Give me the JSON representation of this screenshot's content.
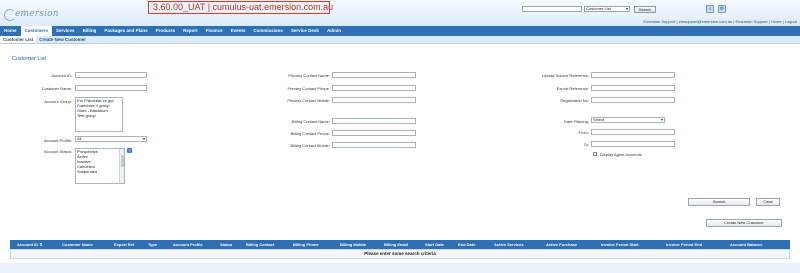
{
  "header": {
    "logo_text": "emersion",
    "environment_label": "3.60.00_UAT | cumulus-uat.emersion.com.au",
    "search": {
      "value": "",
      "select_value": "Customer List",
      "button_label": "Search"
    },
    "icons": [
      "home-icon",
      "settings-icon",
      "help-icon"
    ],
    "user_info": "Emersion Support | emsupport@emersion.com.au | Emersion Support | Home | Logout"
  },
  "nav": {
    "items": [
      {
        "label": "Home"
      },
      {
        "label": "Customers",
        "active": true
      },
      {
        "label": "Services"
      },
      {
        "label": "Billing"
      },
      {
        "label": "Packages and Plans"
      },
      {
        "label": "Products"
      },
      {
        "label": "Report"
      },
      {
        "label": "Finance"
      },
      {
        "label": "Events"
      },
      {
        "label": "Commissions"
      },
      {
        "label": "Service Desk"
      },
      {
        "label": "Admin"
      }
    ]
  },
  "subnav": {
    "items": [
      {
        "label": "Customer List",
        "active": true
      },
      {
        "label": "Create New Customer"
      }
    ]
  },
  "page_title": "Customer List",
  "form": {
    "col1": {
      "account_id": {
        "label": "Account ID:",
        "value": ""
      },
      "customer_name": {
        "label": "Customer Name:",
        "value": ""
      },
      "account_group": {
        "label": "Account Group:",
        "options": [
          "For Franchise zz grp",
          "Franchise Y group",
          "Store - Blackburn",
          "Test group"
        ]
      },
      "account_profile": {
        "label": "Account Profile:",
        "value": "All"
      },
      "account_status": {
        "label": "Account Status:",
        "options": [
          "Prospective",
          "Active",
          "Inactive",
          "Cancelled",
          "Suspended"
        ]
      }
    },
    "col2": {
      "primary_contact_name": {
        "label": "Primary Contact Name:",
        "value": ""
      },
      "primary_contact_phone": {
        "label": "Primary Contact Phone:",
        "value": ""
      },
      "primary_contact_mobile": {
        "label": "Primary Contact Mobile:",
        "value": ""
      },
      "billing_contact_name": {
        "label": "Billing Contact Name:",
        "value": ""
      },
      "billing_contact_phone": {
        "label": "Billing Contact Phone:",
        "value": ""
      },
      "billing_contact_mobile": {
        "label": "Billing Contact Mobile:",
        "value": ""
      }
    },
    "col3": {
      "upload_source_reference": {
        "label": "Upload Source Reference:",
        "value": ""
      },
      "export_reference": {
        "label": "Export Reference:",
        "value": ""
      },
      "registration_no": {
        "label": "Registration No:",
        "value": ""
      },
      "date_filtering": {
        "label": "Date Filtering:",
        "value": "Select"
      },
      "from": {
        "label": "From:",
        "value": ""
      },
      "to": {
        "label": "To:",
        "value": ""
      },
      "display_agent_accounts": {
        "label": "Display Agent Accounts",
        "checked": false
      }
    }
  },
  "buttons": {
    "search": "Search",
    "clear": "Clear",
    "create_new_customer": "Create New Customer"
  },
  "table": {
    "columns": [
      "Account ID",
      "Customer Name",
      "Export Ref",
      "Type",
      "Account Profile",
      "Status",
      "Billing Contact",
      "Billing Phone",
      "Billing Mobile",
      "Billing Email",
      "Start Date",
      "End Date",
      "Active Services",
      "Active Purchase",
      "Invoice Period Start",
      "Invoice Period End",
      "Account Balance"
    ],
    "sort_indicator": "⇅",
    "empty_message": "Please enter some search criteria"
  }
}
